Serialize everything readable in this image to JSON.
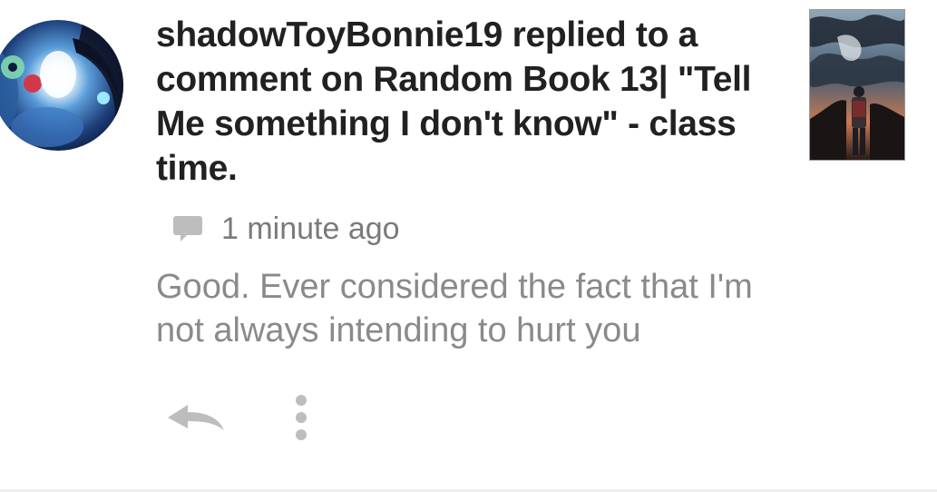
{
  "notification": {
    "title": "shadowToyBonnie19 replied to a comment on Random Book 13| \"Tell Me something I don't know\" - class time.",
    "timestamp": "1 minute ago",
    "comment_text": "Good. Ever considered the fact that I'm not always intending to hurt you"
  },
  "icons": {
    "meta": "comment-bubble-icon",
    "reply": "reply-arrow-icon",
    "more": "more-vertical-icon"
  },
  "colors": {
    "title": "#212121",
    "timestamp": "#7a7a7a",
    "comment_text": "#8a8a8a",
    "icon": "#bdbdbd"
  }
}
